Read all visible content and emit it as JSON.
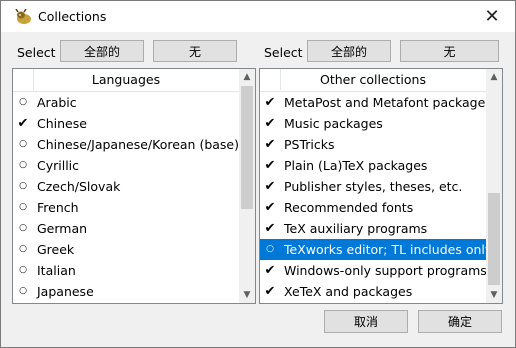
{
  "window": {
    "title": "Collections",
    "app_icon": "gnu-icon",
    "close_icon": "close-icon"
  },
  "left": {
    "select_label": "Select",
    "all_button": "全部的",
    "none_button": "无",
    "header": "Languages",
    "items": [
      {
        "label": "Arabic",
        "mark": "○"
      },
      {
        "label": "Chinese",
        "mark": "✔"
      },
      {
        "label": "Chinese/Japanese/Korean (base)",
        "mark": "○"
      },
      {
        "label": "Cyrillic",
        "mark": "○"
      },
      {
        "label": "Czech/Slovak",
        "mark": "○"
      },
      {
        "label": "French",
        "mark": "○"
      },
      {
        "label": "German",
        "mark": "○"
      },
      {
        "label": "Greek",
        "mark": "○"
      },
      {
        "label": "Italian",
        "mark": "○"
      },
      {
        "label": "Japanese",
        "mark": "○"
      }
    ]
  },
  "right": {
    "select_label": "Select",
    "all_button": "全部的",
    "none_button": "无",
    "header": "Other collections",
    "items": [
      {
        "label": "MetaPost and Metafont packages",
        "mark": "✔"
      },
      {
        "label": "Music packages",
        "mark": "✔"
      },
      {
        "label": "PSTricks",
        "mark": "✔"
      },
      {
        "label": "Plain (La)TeX packages",
        "mark": "✔"
      },
      {
        "label": "Publisher styles, theses, etc.",
        "mark": "✔"
      },
      {
        "label": "Recommended fonts",
        "mark": "✔"
      },
      {
        "label": "TeX auxiliary programs",
        "mark": "✔"
      },
      {
        "label": "TeXworks editor; TL includes only",
        "mark": "○",
        "selected": true
      },
      {
        "label": "Windows-only support programs",
        "mark": "✔"
      },
      {
        "label": "XeTeX and packages",
        "mark": "✔"
      }
    ]
  },
  "footer": {
    "cancel": "取消",
    "ok": "确定"
  }
}
